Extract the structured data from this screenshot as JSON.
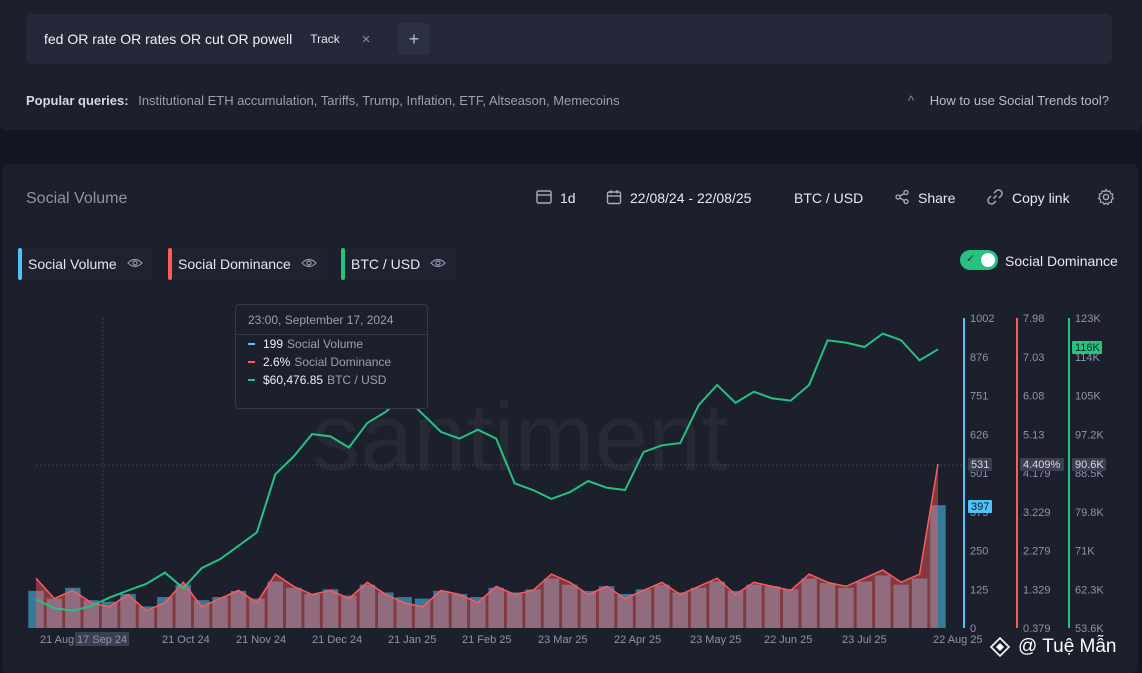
{
  "query": {
    "text": "fed OR rate OR rates OR cut OR powell",
    "track_label": "Track",
    "close_glyph": "×",
    "add_glyph": "+"
  },
  "popular": {
    "label": "Popular queries:",
    "items": "Institutional ETH accumulation, Tariffs, Trump, Inflation, ETF, Altseason, Memecoins"
  },
  "help": {
    "label": "How to use Social Trends tool?"
  },
  "chart_panel": {
    "title": "Social Volume",
    "interval": "1d",
    "date_range": "22/08/24 - 22/08/25",
    "pair": "BTC / USD",
    "share": "Share",
    "copy_link": "Copy link"
  },
  "legend": [
    {
      "label": "Social Volume",
      "color": "#4fc3f7"
    },
    {
      "label": "Social Dominance",
      "color": "#ff5b5b"
    },
    {
      "label": "BTC / USD",
      "color": "#26c281"
    }
  ],
  "toggle": {
    "label": "Social Dominance",
    "on": true
  },
  "watermark_text": "santiment",
  "tooltip": {
    "time": "23:00, September 17, 2024",
    "rows": [
      {
        "value": "199",
        "label": "Social Volume",
        "color": "#4fc3f7"
      },
      {
        "value": "2.6%",
        "label": "Social Dominance",
        "color": "#ff5b5b"
      },
      {
        "value": "$60,476.85",
        "label": "BTC / USD",
        "color": "#26c281"
      }
    ]
  },
  "credit": "@ Tuệ Mẫn",
  "chart_data": {
    "type": "line",
    "x_ticks": [
      "21 Aug",
      "17 Sep 24",
      "21 Oct 24",
      "21 Nov 24",
      "21 Dec 24",
      "21 Jan 25",
      "21 Feb 25",
      "23 Mar 25",
      "22 Apr 25",
      "23 May 25",
      "22 Jun 25",
      "23 Jul 25",
      "22 Aug 25"
    ],
    "axes": {
      "social_volume": {
        "ticks": [
          "1002",
          "876",
          "751",
          "626",
          "501",
          "375",
          "250",
          "125",
          "0"
        ],
        "ylim": [
          0,
          1002
        ],
        "current": "397",
        "crosshair": "531"
      },
      "social_dominance": {
        "ticks": [
          "7.98",
          "7.03",
          "6.08",
          "5.13",
          "4.179",
          "3.229",
          "2.279",
          "1.329",
          "0.379"
        ],
        "ylim": [
          0.379,
          7.98
        ],
        "crosshair": "4.409%"
      },
      "btc_usd": {
        "ticks": [
          "123K",
          "114K",
          "105K",
          "97.2K",
          "88.5K",
          "79.8K",
          "71K",
          "62.3K",
          "53.6K"
        ],
        "ylim": [
          53600,
          123000
        ],
        "current": "116K",
        "crosshair": "90.6K"
      }
    },
    "series": [
      {
        "name": "BTC / USD",
        "color": "#26c281",
        "values": [
          60000,
          58000,
          57500,
          58500,
          60400,
          62000,
          63500,
          66000,
          62500,
          67000,
          69000,
          72000,
          75000,
          88000,
          92000,
          97000,
          96500,
          94000,
          99500,
          102000,
          105500,
          101500,
          97500,
          96000,
          98000,
          96000,
          86000,
          84500,
          82500,
          84000,
          86500,
          85000,
          84500,
          93000,
          94500,
          95000,
          103500,
          108000,
          104000,
          106500,
          105000,
          104500,
          108000,
          118000,
          117500,
          116500,
          119500,
          118000,
          113500,
          116000
        ]
      },
      {
        "name": "Social Volume",
        "color": "#4fc3f7",
        "values": [
          120,
          95,
          130,
          90,
          85,
          110,
          70,
          100,
          140,
          90,
          100,
          120,
          95,
          150,
          130,
          110,
          125,
          105,
          140,
          115,
          100,
          95,
          120,
          110,
          100,
          130,
          115,
          125,
          160,
          140,
          120,
          135,
          110,
          125,
          140,
          115,
          130,
          150,
          120,
          140,
          135,
          125,
          160,
          145,
          130,
          150,
          170,
          140,
          160,
          397
        ]
      },
      {
        "name": "Social Dominance",
        "color": "#ff5b5b",
        "values": [
          1.6,
          1.1,
          1.3,
          1.0,
          0.9,
          1.2,
          0.8,
          1.0,
          1.5,
          0.9,
          1.1,
          1.3,
          1.0,
          1.7,
          1.4,
          1.2,
          1.3,
          1.1,
          1.5,
          1.2,
          1.0,
          0.9,
          1.3,
          1.2,
          1.0,
          1.4,
          1.2,
          1.3,
          1.7,
          1.5,
          1.2,
          1.4,
          1.1,
          1.3,
          1.5,
          1.2,
          1.4,
          1.6,
          1.2,
          1.5,
          1.4,
          1.3,
          1.7,
          1.5,
          1.4,
          1.6,
          1.8,
          1.5,
          1.7,
          4.4
        ]
      }
    ]
  }
}
